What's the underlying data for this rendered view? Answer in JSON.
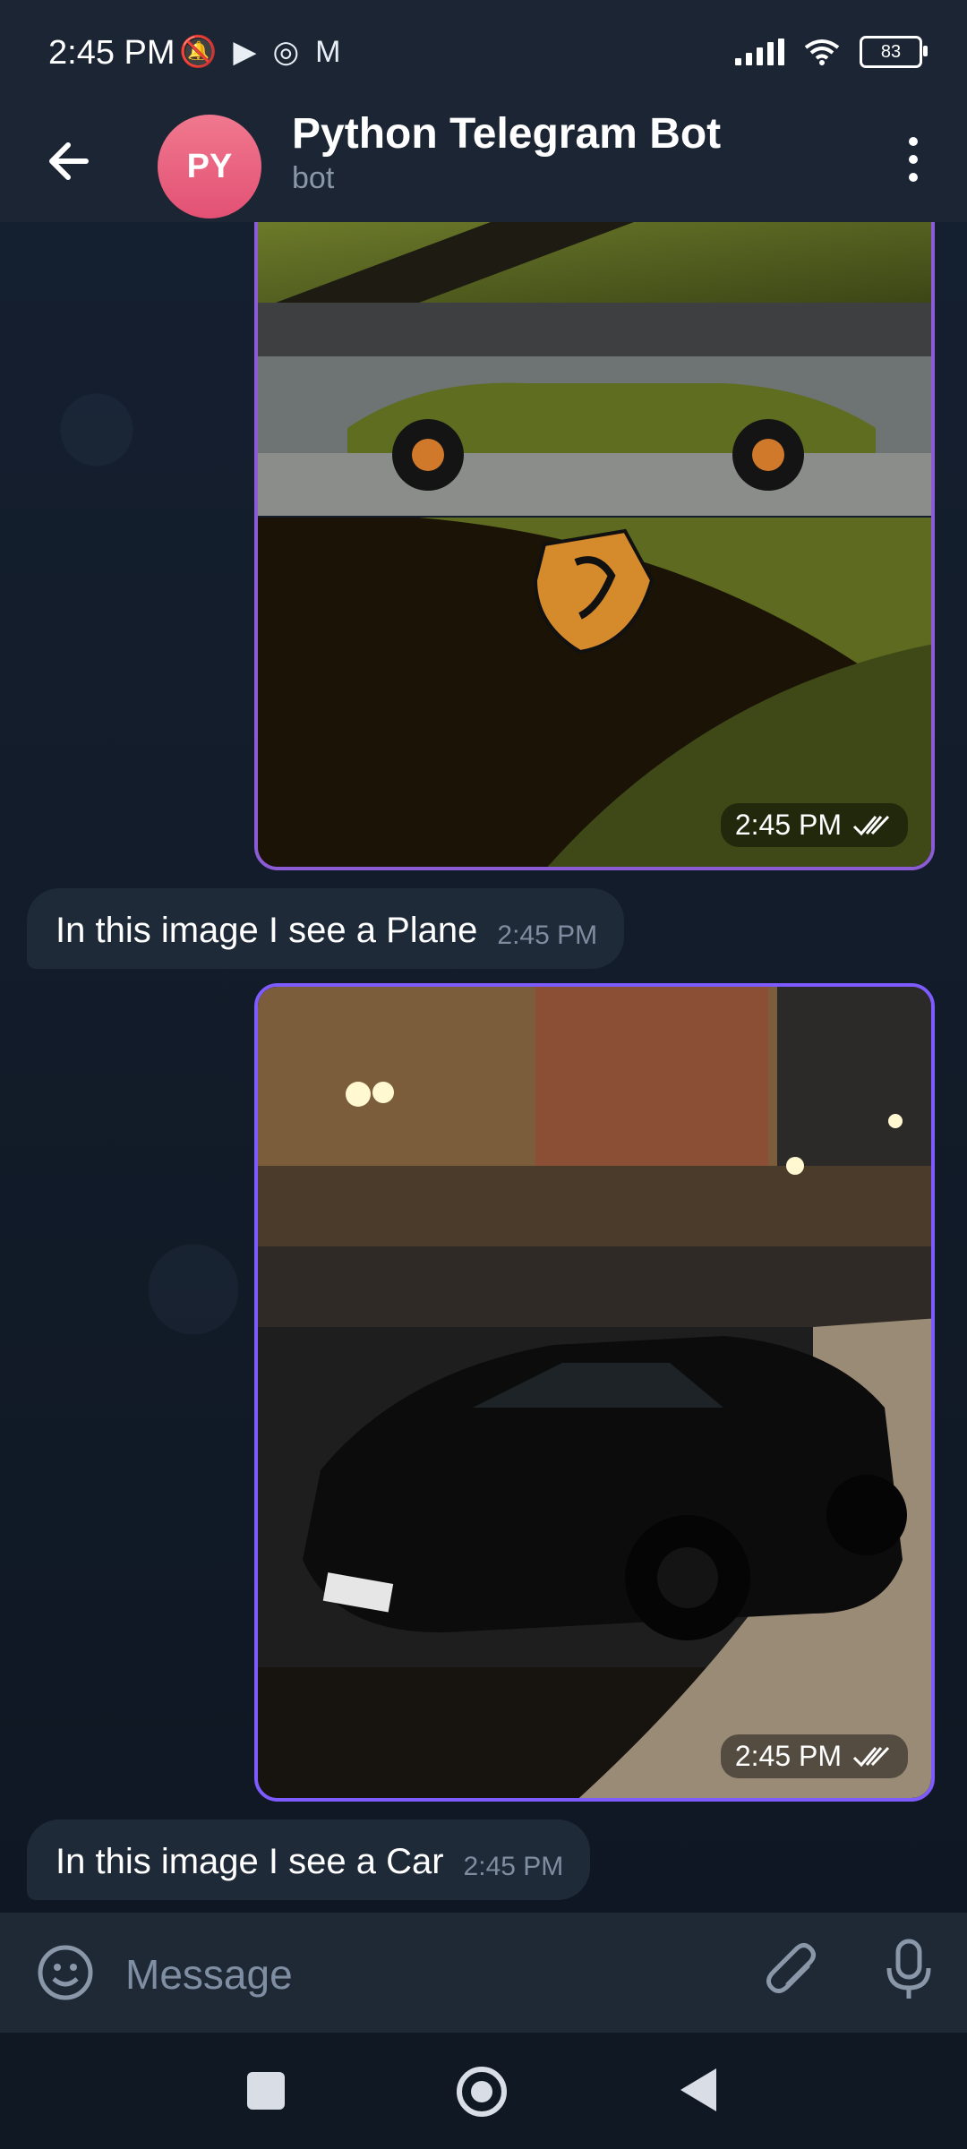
{
  "status_bar": {
    "time": "2:45 PM",
    "left_icons": [
      "bell-off-icon",
      "play-icon",
      "radio-icon",
      "gmail-icon"
    ],
    "battery": "83"
  },
  "header": {
    "avatar_text": "PY",
    "title": "Python Telegram Bot",
    "subtitle": "bot"
  },
  "messages": [
    {
      "type": "photo",
      "time": "2:45 PM",
      "status": "read",
      "description": "olive green Ferrari"
    },
    {
      "type": "text",
      "text": "In this image I see a Plane",
      "time": "2:45 PM"
    },
    {
      "type": "photo",
      "time": "2:45 PM",
      "status": "read",
      "description": "black Audi R8 at night"
    },
    {
      "type": "text",
      "text": "In this image I see a Car",
      "time": "2:45 PM"
    }
  ],
  "composer": {
    "placeholder": "Message"
  },
  "colors": {
    "bubble_border": "#8c5bd6",
    "avatar": "#e35174"
  }
}
